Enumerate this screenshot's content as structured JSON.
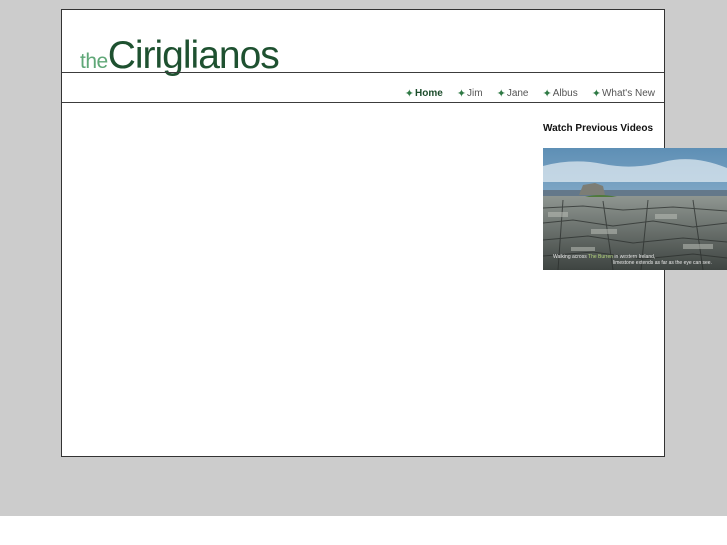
{
  "site": {
    "logo_prefix": "the",
    "logo_main": "Ciriglianos"
  },
  "nav": {
    "items": [
      {
        "label": "Home",
        "active": true
      },
      {
        "label": "Jim",
        "active": false
      },
      {
        "label": "Jane",
        "active": false
      },
      {
        "label": "Albus",
        "active": false
      },
      {
        "label": "What's New",
        "active": false
      }
    ],
    "bullet_icon": "star-icon"
  },
  "videos": {
    "heading": "Watch Previous Videos",
    "caption_line1_pre": "Walking across ",
    "caption_highlight": "The Burren",
    "caption_line1_post": " in western Ireland,",
    "caption_line2": "limestone extends as far as the eye can see."
  },
  "colors": {
    "page_bg": "#cccccc",
    "logo_green": "#1e5130",
    "logo_light_green": "#5fa777",
    "nav_icon_green": "#2f7a45"
  }
}
